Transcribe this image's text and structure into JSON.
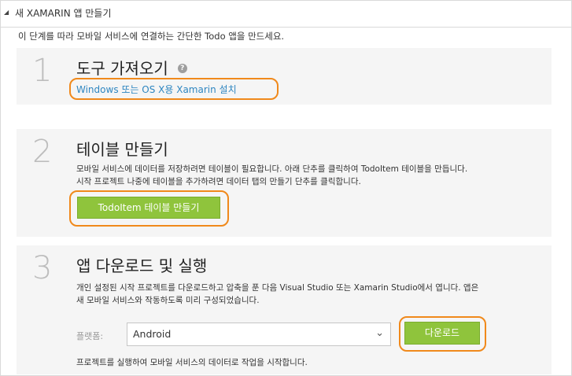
{
  "header": {
    "title": "새 XAMARIN 앱 만들기",
    "toggle_icon": "collapse-triangle-icon"
  },
  "intro": "이 단계를 따라 모바일 서비스에 연결하는 간단한 Todo 앱을 만드세요.",
  "steps": [
    {
      "number": "1",
      "title": "도구 가져오기",
      "help_glyph": "?",
      "link": "Windows 또는 OS X용 Xamarin 설치"
    },
    {
      "number": "2",
      "title": "테이블 만들기",
      "desc_line1": "모바일 서비스에 데이터를 저장하려면 테이블이 필요합니다. 아래 단추를 클릭하여 TodoItem 테이블을 만듭니다.",
      "desc_line2": "시작 프로젝트 나중에 테이블을 추가하려면 데이터 탭의 만들기 단추를 클릭합니다.",
      "button": "TodoItem 테이블 만들기"
    },
    {
      "number": "3",
      "title": "앱 다운로드 및 실행",
      "desc_line1": "개인 설정된 시작 프로젝트를 다운로드하고 압축을 푼 다음 Visual Studio 또는 Xamarin Studio에서 엽니다. 앱은",
      "desc_line2": "새 모바일 서비스와 작동하도록 미리 구성되었습니다.",
      "platform_label": "플랫폼:",
      "platform_value": "Android",
      "button": "다운로드",
      "note": "프로젝트를 실행하여 모바일 서비스의 데이터로 작업을 시작합니다."
    }
  ],
  "colors": {
    "accent_button": "#8fc43c",
    "highlight_ring": "#f0891b",
    "link": "#2e86c1"
  }
}
